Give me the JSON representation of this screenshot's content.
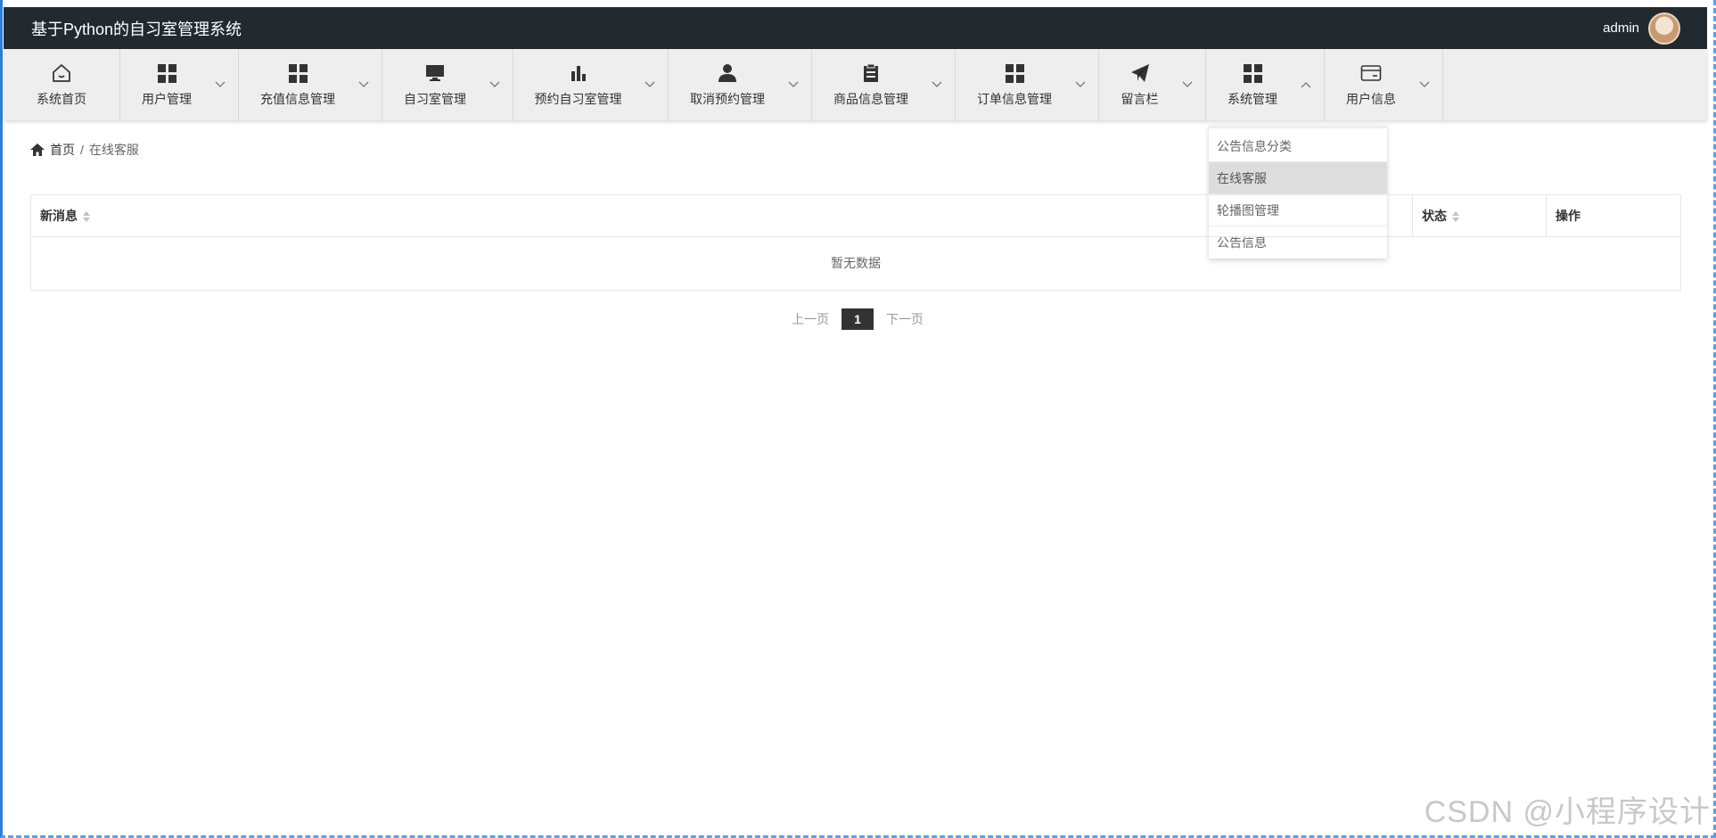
{
  "header": {
    "title": "基于Python的自习室管理系统",
    "user_name": "admin"
  },
  "nav": {
    "items": [
      {
        "label": "系统首页",
        "icon": "home-icon"
      },
      {
        "label": "用户管理",
        "icon": "grid-icon"
      },
      {
        "label": "充值信息管理",
        "icon": "grid-icon"
      },
      {
        "label": "自习室管理",
        "icon": "monitor-icon"
      },
      {
        "label": "预约自习室管理",
        "icon": "bar-chart-icon"
      },
      {
        "label": "取消预约管理",
        "icon": "person-icon"
      },
      {
        "label": "商品信息管理",
        "icon": "clipboard-icon"
      },
      {
        "label": "订单信息管理",
        "icon": "grid-icon"
      },
      {
        "label": "留言栏",
        "icon": "paper-plane-icon"
      },
      {
        "label": "系统管理",
        "icon": "grid-icon"
      },
      {
        "label": "用户信息",
        "icon": "card-icon"
      }
    ]
  },
  "dropdown": {
    "items": [
      {
        "label": "公告信息分类"
      },
      {
        "label": "在线客服",
        "active": true
      },
      {
        "label": "轮播图管理"
      },
      {
        "label": "公告信息"
      }
    ]
  },
  "breadcrumb": {
    "home": "首页",
    "separator": "/",
    "current": "在线客服"
  },
  "table": {
    "columns": [
      "新消息",
      "状态",
      "操作"
    ],
    "empty_text": "暂无数据"
  },
  "pager": {
    "prev": "上一页",
    "current": "1",
    "next": "下一页"
  },
  "watermark": "CSDN @小程序设计",
  "colors": {
    "topbar": "#222a30",
    "navbar": "#eeeeee",
    "active_item": "#dddddd",
    "page_btn": "#333333"
  }
}
